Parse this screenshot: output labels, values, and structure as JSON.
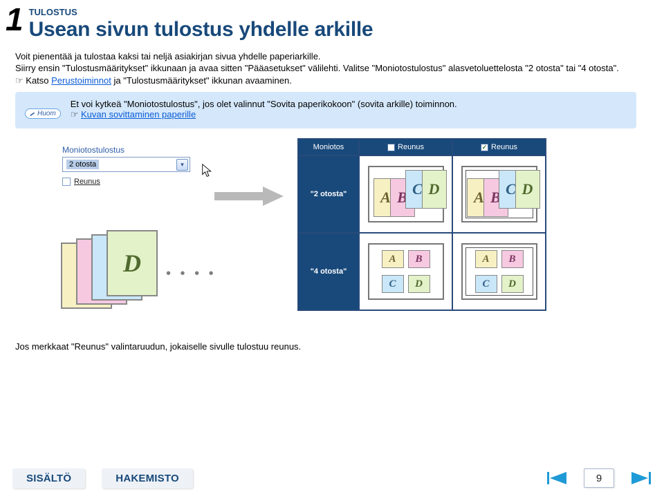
{
  "chapter_number": "1",
  "category": "TULOSTUS",
  "title": "Usean sivun tulostus yhdelle arkille",
  "paragraphs": {
    "p1": "Voit pienentää ja tulostaa kaksi tai neljä asiakirjan sivua yhdelle paperiarkille.",
    "p2a": "Siirry ensin \"Tulostusmääritykset\" ikkunaan ja avaa sitten \"Pääasetukset\" välilehti. Valitse \"Moniotostulostus\" alasvetoluettelosta \"2 otosta\" tai \"4 otosta\".",
    "p3_pre": "Katso ",
    "p3_link": "Perustoiminnot",
    "p3_post": " ja \"Tulostusmääritykset\" ikkunan avaaminen."
  },
  "note": {
    "badge": "Huom",
    "line1": "Et voi kytkeä \"Moniotostulostus\", jos olet valinnut \"Sovita paperikokoon\" (sovita arkille) toiminnon.",
    "link": "Kuvan sovittaminen paperille"
  },
  "dropdown": {
    "title": "Moniotostulostus",
    "selected": "2 otosta",
    "checkbox_label": "Reunus"
  },
  "grid": {
    "header_col0": "Moniotos",
    "header_col1": "Reunus",
    "header_col2": "Reunus",
    "row2_label": "\"2 otosta\"",
    "row4_label": "\"4 otosta\""
  },
  "tiles": {
    "A": "A",
    "B": "B",
    "C": "C",
    "D": "D"
  },
  "footer_text": "Jos merkkaat \"Reunus\" valintaruudun, jokaiselle sivulle tulostuu reunus.",
  "nav": {
    "contents": "SISÄLTÖ",
    "index": "HAKEMISTO",
    "page": "9"
  }
}
